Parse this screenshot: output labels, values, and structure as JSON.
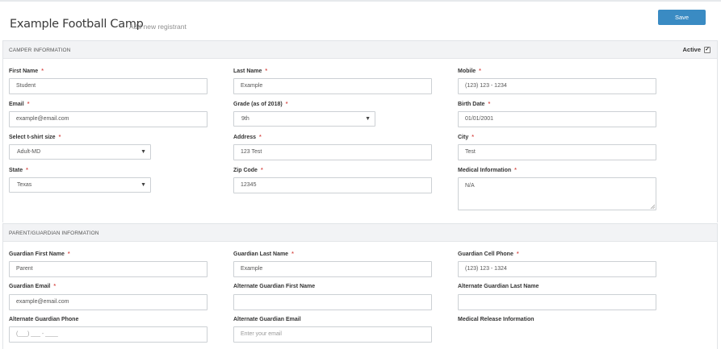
{
  "page": {
    "title": "Example Football Camp",
    "subtitle": "Add new registrant",
    "save_label": "Save"
  },
  "camper": {
    "heading": "CAMPER INFORMATION",
    "active_label": "Active",
    "active_checked": true,
    "first_name": {
      "label": "First Name",
      "value": "Student"
    },
    "last_name": {
      "label": "Last Name",
      "value": "Example"
    },
    "mobile": {
      "label": "Mobile",
      "value": "(123) 123 - 1234"
    },
    "email": {
      "label": "Email",
      "value": "example@email.com"
    },
    "grade": {
      "label": "Grade (as of 2018)",
      "value": "9th"
    },
    "birth_date": {
      "label": "Birth Date",
      "value": "01/01/2001"
    },
    "tshirt": {
      "label": "Select t-shirt size",
      "value": "Adult-MD"
    },
    "address": {
      "label": "Address",
      "value": "123 Test"
    },
    "city": {
      "label": "City",
      "value": "Test"
    },
    "state": {
      "label": "State",
      "value": "Texas"
    },
    "zip": {
      "label": "Zip Code",
      "value": "12345"
    },
    "medical": {
      "label": "Medical Information",
      "value": "N/A"
    }
  },
  "guardian": {
    "heading": "PARENT/GUARDIAN INFORMATION",
    "first_name": {
      "label": "Guardian First Name",
      "value": "Parent"
    },
    "last_name": {
      "label": "Guardian Last Name",
      "value": "Example"
    },
    "cell": {
      "label": "Guardian Cell Phone",
      "value": "(123) 123 - 1324"
    },
    "email": {
      "label": "Guardian Email",
      "value": "example@email.com"
    },
    "alt_first": {
      "label": "Alternate Guardian First Name",
      "value": ""
    },
    "alt_last": {
      "label": "Alternate Guardian Last Name",
      "value": ""
    },
    "alt_phone": {
      "label": "Alternate Guardian Phone",
      "placeholder": "(___) ___ - ____"
    },
    "alt_email": {
      "label": "Alternate Guardian Email",
      "placeholder": "Enter your email"
    },
    "release": {
      "label": "Medical Release Information"
    }
  },
  "colors": {
    "accent": "#3a8bc3",
    "required": "#d9534f",
    "section_header": "#f2f3f5"
  },
  "icons": {
    "dropdown": "caret-down-icon",
    "checkbox": "checkbox-checked-icon",
    "resize": "resize-grip-icon"
  }
}
